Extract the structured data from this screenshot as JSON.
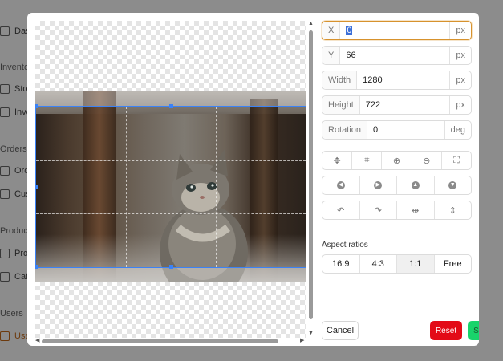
{
  "sidebar": {
    "items": [
      {
        "label": "Dashboard",
        "icon": "home-icon"
      },
      {
        "label": "Stock",
        "icon": "sliders-icon"
      },
      {
        "label": "Inventory",
        "icon": "box-icon"
      },
      {
        "label": "Orders",
        "icon": "bag-icon"
      },
      {
        "label": "Customers",
        "icon": "users-icon"
      },
      {
        "label": "Products",
        "icon": "tag-icon"
      },
      {
        "label": "Categories",
        "icon": "folder-icon"
      },
      {
        "label": "Users",
        "icon": "users-icon"
      }
    ],
    "sections": [
      "Inventory",
      "Orders",
      "Products",
      "Users"
    ]
  },
  "editor": {
    "fields": {
      "x": {
        "label": "X",
        "value": "0",
        "unit": "px"
      },
      "y": {
        "label": "Y",
        "value": "66",
        "unit": "px"
      },
      "width": {
        "label": "Width",
        "value": "1280",
        "unit": "px"
      },
      "height": {
        "label": "Height",
        "value": "722",
        "unit": "px"
      },
      "rotation": {
        "label": "Rotation",
        "value": "0",
        "unit": "deg"
      }
    },
    "tool_row_1": [
      "move-icon",
      "crop-icon",
      "zoom-in-icon",
      "zoom-out-icon",
      "fullscreen-icon"
    ],
    "tool_row_2": [
      "arrow-left-circle-icon",
      "arrow-right-circle-icon",
      "arrow-up-circle-icon",
      "arrow-down-circle-icon"
    ],
    "tool_row_3": [
      "rotate-left-icon",
      "rotate-right-icon",
      "flip-horizontal-icon",
      "flip-vertical-icon"
    ],
    "aspect": {
      "title": "Aspect ratios",
      "options": [
        "16:9",
        "4:3",
        "1:1",
        "Free"
      ],
      "selected": "1:1"
    },
    "buttons": {
      "cancel": "Cancel",
      "reset": "Reset",
      "save": "Save"
    },
    "colors": {
      "accent": "#d7922d",
      "crop_border": "#3b82f6",
      "reset": "#e30b17",
      "save": "#19d46b"
    }
  }
}
